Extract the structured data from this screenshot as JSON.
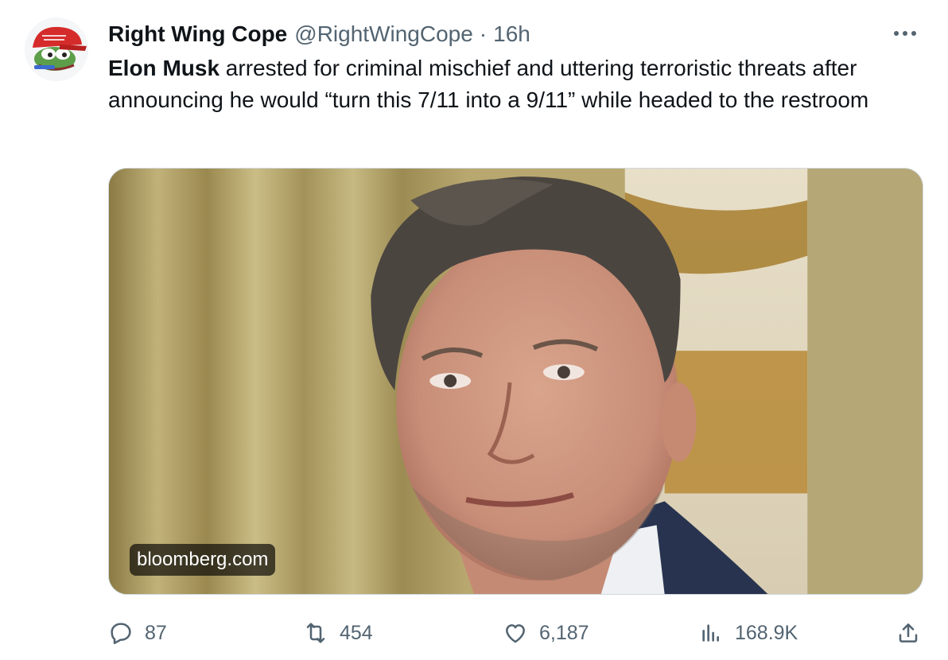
{
  "author": {
    "display_name": "Right Wing Cope",
    "handle": "@RightWingCope",
    "separator": "·",
    "time": "16h",
    "avatar_icon": "frog-in-red-cap-avatar"
  },
  "tweet": {
    "mention_bold": "Elon Musk",
    "body": " arrested for criminal mischief and uttering terroristic threats after announcing he would “turn this 7/11 into a 9/11” while headed to the restroom"
  },
  "media": {
    "source_label": "bloomberg.com"
  },
  "actions": {
    "replies": "87",
    "reposts": "454",
    "likes": "6,187",
    "views": "168.9K"
  },
  "colors": {
    "text_primary": "#0f1419",
    "text_secondary": "#536471",
    "border": "#cfd9de"
  }
}
